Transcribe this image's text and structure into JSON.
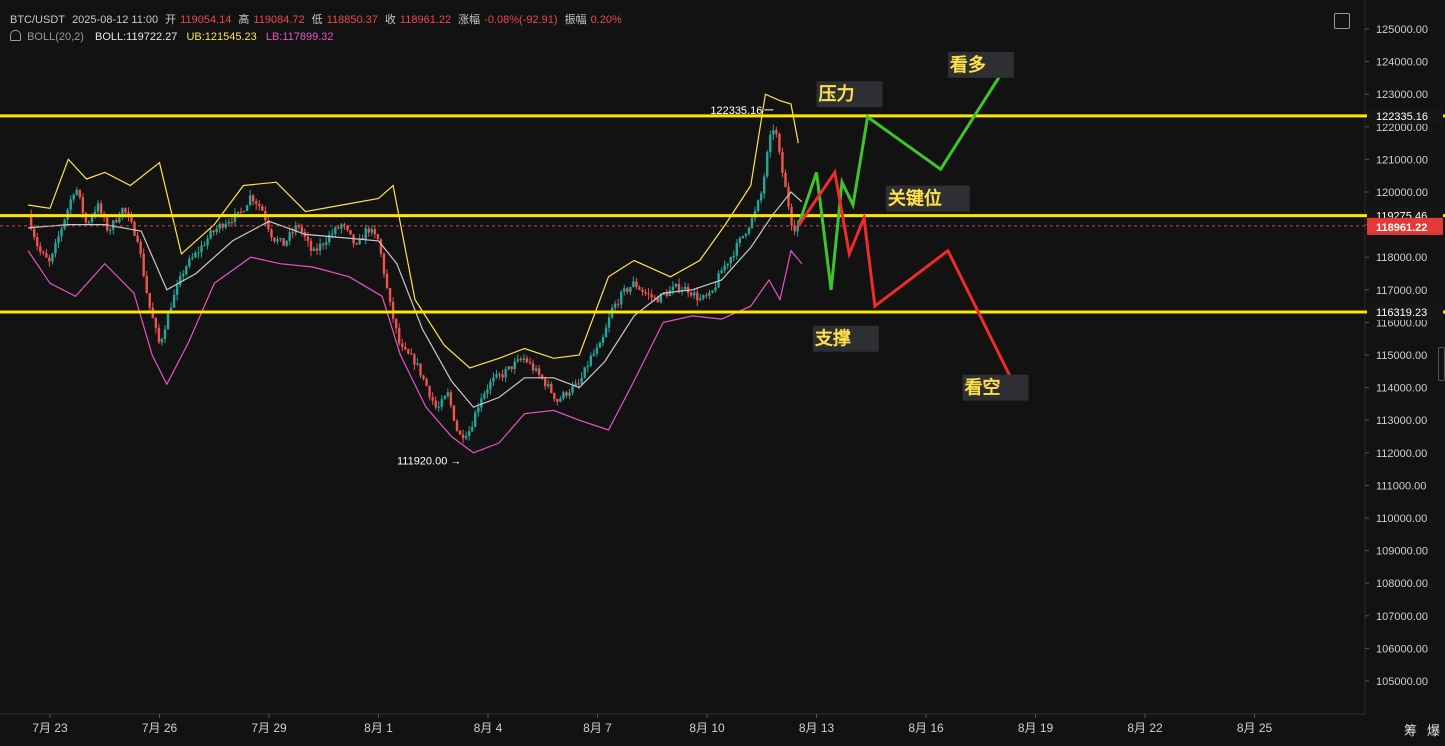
{
  "header": {
    "symbol": "BTC/USDT",
    "datetime": "2025-08-12 11:00",
    "open_label": "开",
    "open": "119054.14",
    "high_label": "高",
    "high": "119084.72",
    "low_label": "低",
    "low": "118850.37",
    "close_label": "收",
    "close": "118961.22",
    "change_label": "涨幅",
    "change": "-0.08%(-92.91)",
    "amp_label": "振幅",
    "amp": "0.20%",
    "boll_label": "BOLL(20,2)",
    "boll_mid": "BOLL:119722.27",
    "boll_ub": "UB:121545.23",
    "boll_lb": "LB:117899.32"
  },
  "corner_labels": [
    "筹",
    "爆"
  ],
  "chart_data": {
    "type": "candlestick",
    "y_axis": {
      "min": 104500,
      "max": 125500,
      "ticks": [
        "125000.00",
        "124000.00",
        "123000.00",
        "122000.00",
        "121000.00",
        "120000.00",
        "119000.00",
        "118000.00",
        "117000.00",
        "116000.00",
        "115000.00",
        "114000.00",
        "113000.00",
        "112000.00",
        "111000.00",
        "110000.00",
        "109000.00",
        "108000.00",
        "107000.00",
        "106000.00",
        "105000.00"
      ]
    },
    "x_axis": {
      "ticks": [
        {
          "label": "7月 23",
          "day": 0
        },
        {
          "label": "7月 26",
          "day": 3
        },
        {
          "label": "7月 29",
          "day": 6
        },
        {
          "label": "8月 1",
          "day": 9
        },
        {
          "label": "8月 4",
          "day": 12
        },
        {
          "label": "8月 7",
          "day": 15
        },
        {
          "label": "8月 10",
          "day": 18
        },
        {
          "label": "8月 13",
          "day": 21
        },
        {
          "label": "8月 16",
          "day": 24
        },
        {
          "label": "8月 19",
          "day": 27
        },
        {
          "label": "8月 22",
          "day": 30
        },
        {
          "label": "8月 25",
          "day": 33
        }
      ]
    },
    "price_path": [
      [
        -0.6,
        119300
      ],
      [
        -0.3,
        118200
      ],
      [
        0,
        117800
      ],
      [
        0.4,
        119200
      ],
      [
        0.7,
        120200
      ],
      [
        1.0,
        119000
      ],
      [
        1.3,
        119600
      ],
      [
        1.6,
        118800
      ],
      [
        2.0,
        119500
      ],
      [
        2.4,
        118600
      ],
      [
        2.7,
        116600
      ],
      [
        3.0,
        115300
      ],
      [
        3.3,
        116500
      ],
      [
        3.7,
        117700
      ],
      [
        4.0,
        118100
      ],
      [
        4.4,
        118700
      ],
      [
        4.8,
        119100
      ],
      [
        5.2,
        119300
      ],
      [
        5.5,
        119900
      ],
      [
        5.8,
        119500
      ],
      [
        6.1,
        118600
      ],
      [
        6.4,
        118400
      ],
      [
        6.8,
        119000
      ],
      [
        7.2,
        118100
      ],
      [
        7.6,
        118600
      ],
      [
        8.0,
        119000
      ],
      [
        8.4,
        118300
      ],
      [
        8.7,
        118900
      ],
      [
        9.0,
        118500
      ],
      [
        9.3,
        116600
      ],
      [
        9.6,
        115200
      ],
      [
        10.0,
        114800
      ],
      [
        10.3,
        114100
      ],
      [
        10.6,
        113300
      ],
      [
        10.9,
        113800
      ],
      [
        11.2,
        112500
      ],
      [
        11.5,
        112700
      ],
      [
        11.8,
        113700
      ],
      [
        12.1,
        114200
      ],
      [
        12.4,
        114400
      ],
      [
        12.7,
        114700
      ],
      [
        13.0,
        114900
      ],
      [
        13.3,
        114500
      ],
      [
        13.6,
        114100
      ],
      [
        13.9,
        113600
      ],
      [
        14.2,
        113900
      ],
      [
        14.5,
        114100
      ],
      [
        14.8,
        114900
      ],
      [
        15.1,
        115300
      ],
      [
        15.4,
        116400
      ],
      [
        15.7,
        116900
      ],
      [
        16.0,
        117200
      ],
      [
        16.3,
        116900
      ],
      [
        16.6,
        116700
      ],
      [
        16.9,
        116900
      ],
      [
        17.2,
        117100
      ],
      [
        17.5,
        117000
      ],
      [
        17.8,
        116700
      ],
      [
        18.1,
        116800
      ],
      [
        18.4,
        117600
      ],
      [
        18.7,
        118100
      ],
      [
        19.0,
        118700
      ],
      [
        19.3,
        119300
      ],
      [
        19.5,
        120000
      ],
      [
        19.7,
        121500
      ],
      [
        19.85,
        122100
      ],
      [
        20.0,
        121000
      ],
      [
        20.2,
        119800
      ],
      [
        20.35,
        118900
      ],
      [
        20.5,
        118961
      ]
    ],
    "mid_path": [
      [
        -0.6,
        118900
      ],
      [
        0.5,
        119000
      ],
      [
        1.5,
        119000
      ],
      [
        2.5,
        118800
      ],
      [
        3.2,
        117000
      ],
      [
        4.0,
        117500
      ],
      [
        5.0,
        118500
      ],
      [
        6.0,
        119100
      ],
      [
        7.0,
        118700
      ],
      [
        8.0,
        118600
      ],
      [
        9.0,
        118500
      ],
      [
        9.5,
        117800
      ],
      [
        10.2,
        115800
      ],
      [
        11.0,
        114200
      ],
      [
        11.6,
        113400
      ],
      [
        12.3,
        113700
      ],
      [
        13.0,
        114300
      ],
      [
        13.8,
        114300
      ],
      [
        14.5,
        114000
      ],
      [
        15.2,
        114800
      ],
      [
        16.0,
        116200
      ],
      [
        16.8,
        116900
      ],
      [
        17.6,
        117000
      ],
      [
        18.4,
        117300
      ],
      [
        19.2,
        118300
      ],
      [
        19.8,
        119300
      ],
      [
        20.3,
        120000
      ],
      [
        20.6,
        119700
      ]
    ],
    "ub_path": [
      [
        -0.6,
        119600
      ],
      [
        0,
        119500
      ],
      [
        0.5,
        121000
      ],
      [
        1.0,
        120400
      ],
      [
        1.5,
        120600
      ],
      [
        2.2,
        120200
      ],
      [
        3.0,
        120900
      ],
      [
        3.6,
        118100
      ],
      [
        4.5,
        119000
      ],
      [
        5.3,
        120200
      ],
      [
        6.2,
        120300
      ],
      [
        7.0,
        119400
      ],
      [
        8.0,
        119600
      ],
      [
        9.0,
        119800
      ],
      [
        9.4,
        120200
      ],
      [
        10.0,
        116700
      ],
      [
        10.8,
        115300
      ],
      [
        11.5,
        114600
      ],
      [
        12.3,
        114900
      ],
      [
        13.0,
        115200
      ],
      [
        13.8,
        114900
      ],
      [
        14.5,
        115000
      ],
      [
        15.3,
        117400
      ],
      [
        16.0,
        117900
      ],
      [
        17.0,
        117400
      ],
      [
        17.8,
        117900
      ],
      [
        18.5,
        119000
      ],
      [
        19.2,
        120200
      ],
      [
        19.6,
        123000
      ],
      [
        20.0,
        122800
      ],
      [
        20.3,
        122700
      ],
      [
        20.5,
        121500
      ]
    ],
    "lb_path": [
      [
        -0.6,
        118200
      ],
      [
        0,
        117200
      ],
      [
        0.7,
        116800
      ],
      [
        1.5,
        117800
      ],
      [
        2.3,
        116900
      ],
      [
        2.8,
        115000
      ],
      [
        3.2,
        114100
      ],
      [
        3.8,
        115400
      ],
      [
        4.5,
        117200
      ],
      [
        5.5,
        118000
      ],
      [
        6.3,
        117800
      ],
      [
        7.2,
        117700
      ],
      [
        8.2,
        117400
      ],
      [
        9.1,
        116800
      ],
      [
        9.6,
        115000
      ],
      [
        10.3,
        113400
      ],
      [
        11.0,
        112500
      ],
      [
        11.6,
        112000
      ],
      [
        12.3,
        112300
      ],
      [
        13.0,
        113200
      ],
      [
        13.8,
        113300
      ],
      [
        14.5,
        113000
      ],
      [
        15.3,
        112700
      ],
      [
        16.0,
        114200
      ],
      [
        16.8,
        116000
      ],
      [
        17.6,
        116200
      ],
      [
        18.4,
        116100
      ],
      [
        19.2,
        116500
      ],
      [
        19.7,
        117300
      ],
      [
        20.0,
        116700
      ],
      [
        20.3,
        118200
      ],
      [
        20.6,
        117800
      ]
    ],
    "hlines": [
      {
        "value": 122335.16,
        "label": "122335.16"
      },
      {
        "value": 119275.46,
        "label": "119275.46"
      },
      {
        "value": 116319.23,
        "label": "116319.23"
      }
    ],
    "current_price": {
      "value": 118961.22,
      "label": "118961.22"
    },
    "extremes": [
      {
        "label": "122335.16",
        "day": 19.9,
        "value": 122335.16,
        "pos": "above"
      },
      {
        "label": "111920.00",
        "day": 11.6,
        "value": 111920.0,
        "pos": "below"
      }
    ],
    "scenario_bull": [
      [
        20.5,
        118961
      ],
      [
        21.0,
        120600
      ],
      [
        21.4,
        117000
      ],
      [
        21.7,
        120300
      ],
      [
        22.0,
        119600
      ],
      [
        22.4,
        122300
      ],
      [
        24.4,
        120700
      ],
      [
        26.1,
        123700
      ]
    ],
    "scenario_bear": [
      [
        20.5,
        118961
      ],
      [
        21.5,
        120600
      ],
      [
        21.9,
        118100
      ],
      [
        22.3,
        119200
      ],
      [
        22.6,
        116500
      ],
      [
        24.6,
        118200
      ],
      [
        26.5,
        113900
      ]
    ],
    "annotations": [
      {
        "text": "压力",
        "day": 21.0,
        "value": 123000
      },
      {
        "text": "看多",
        "day": 24.6,
        "value": 123900
      },
      {
        "text": "关键位",
        "day": 22.9,
        "value": 119800
      },
      {
        "text": "支撑",
        "day": 20.9,
        "value": 115500
      },
      {
        "text": "看空",
        "day": 25.0,
        "value": 114000
      }
    ],
    "colors": {
      "background": "#121212",
      "up": "#26a69a",
      "down": "#ef5350",
      "mid": "#c9c9c9",
      "ub": "#ffe24a",
      "lb": "#e653c7",
      "hline": "#ffe600",
      "bull": "#3fc42c",
      "bear": "#ef2b2b",
      "annotation_text": "#ffe24a",
      "annotation_bg": "#2e2f33",
      "price_tag": "#e53935"
    }
  }
}
